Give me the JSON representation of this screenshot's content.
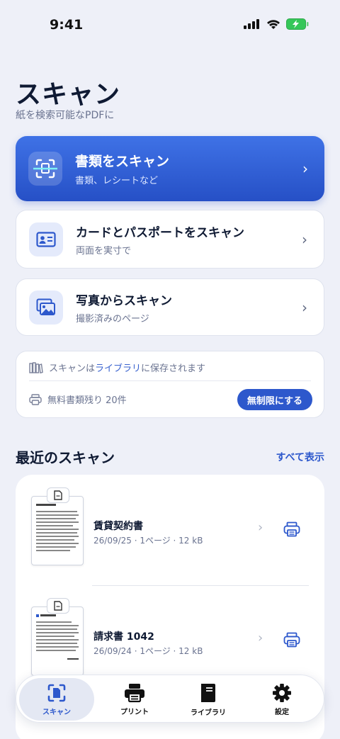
{
  "status_bar": {
    "time": "9:41"
  },
  "header": {
    "title": "スキャン",
    "subtitle": "紙を検索可能なPDFに"
  },
  "actions": [
    {
      "title": "書類をスキャン",
      "subtitle": "書類、レシートなど",
      "icon": "document-scan-icon"
    },
    {
      "title": "カードとパスポートをスキャン",
      "subtitle": "両面を実寸で",
      "icon": "id-card-icon"
    },
    {
      "title": "写真からスキャン",
      "subtitle": "撮影済みのページ",
      "icon": "photos-icon"
    }
  ],
  "info": {
    "save_prefix": "スキャンは",
    "save_link": "ライブラリ",
    "save_suffix": "に保存されます",
    "remaining": "無料書類残り 20件",
    "unlimited_button": "無制限にする"
  },
  "recent": {
    "title": "最近のスキャン",
    "see_all": "すべて表示",
    "items": [
      {
        "name": "賃貸契約書",
        "meta": "26/09/25 · 1ページ · 12 kB"
      },
      {
        "name": "請求書 1042",
        "meta": "26/09/24 · 1ページ · 12 kB"
      }
    ]
  },
  "tabs": [
    {
      "label": "スキャン",
      "icon": "scan-icon",
      "active": true
    },
    {
      "label": "プリント",
      "icon": "printer-icon",
      "active": false
    },
    {
      "label": "ライブラリ",
      "icon": "library-icon",
      "active": false
    },
    {
      "label": "設定",
      "icon": "gear-icon",
      "active": false
    }
  ],
  "colors": {
    "accent": "#2d58cc",
    "background": "#eef0f8",
    "battery": "#35c759"
  }
}
